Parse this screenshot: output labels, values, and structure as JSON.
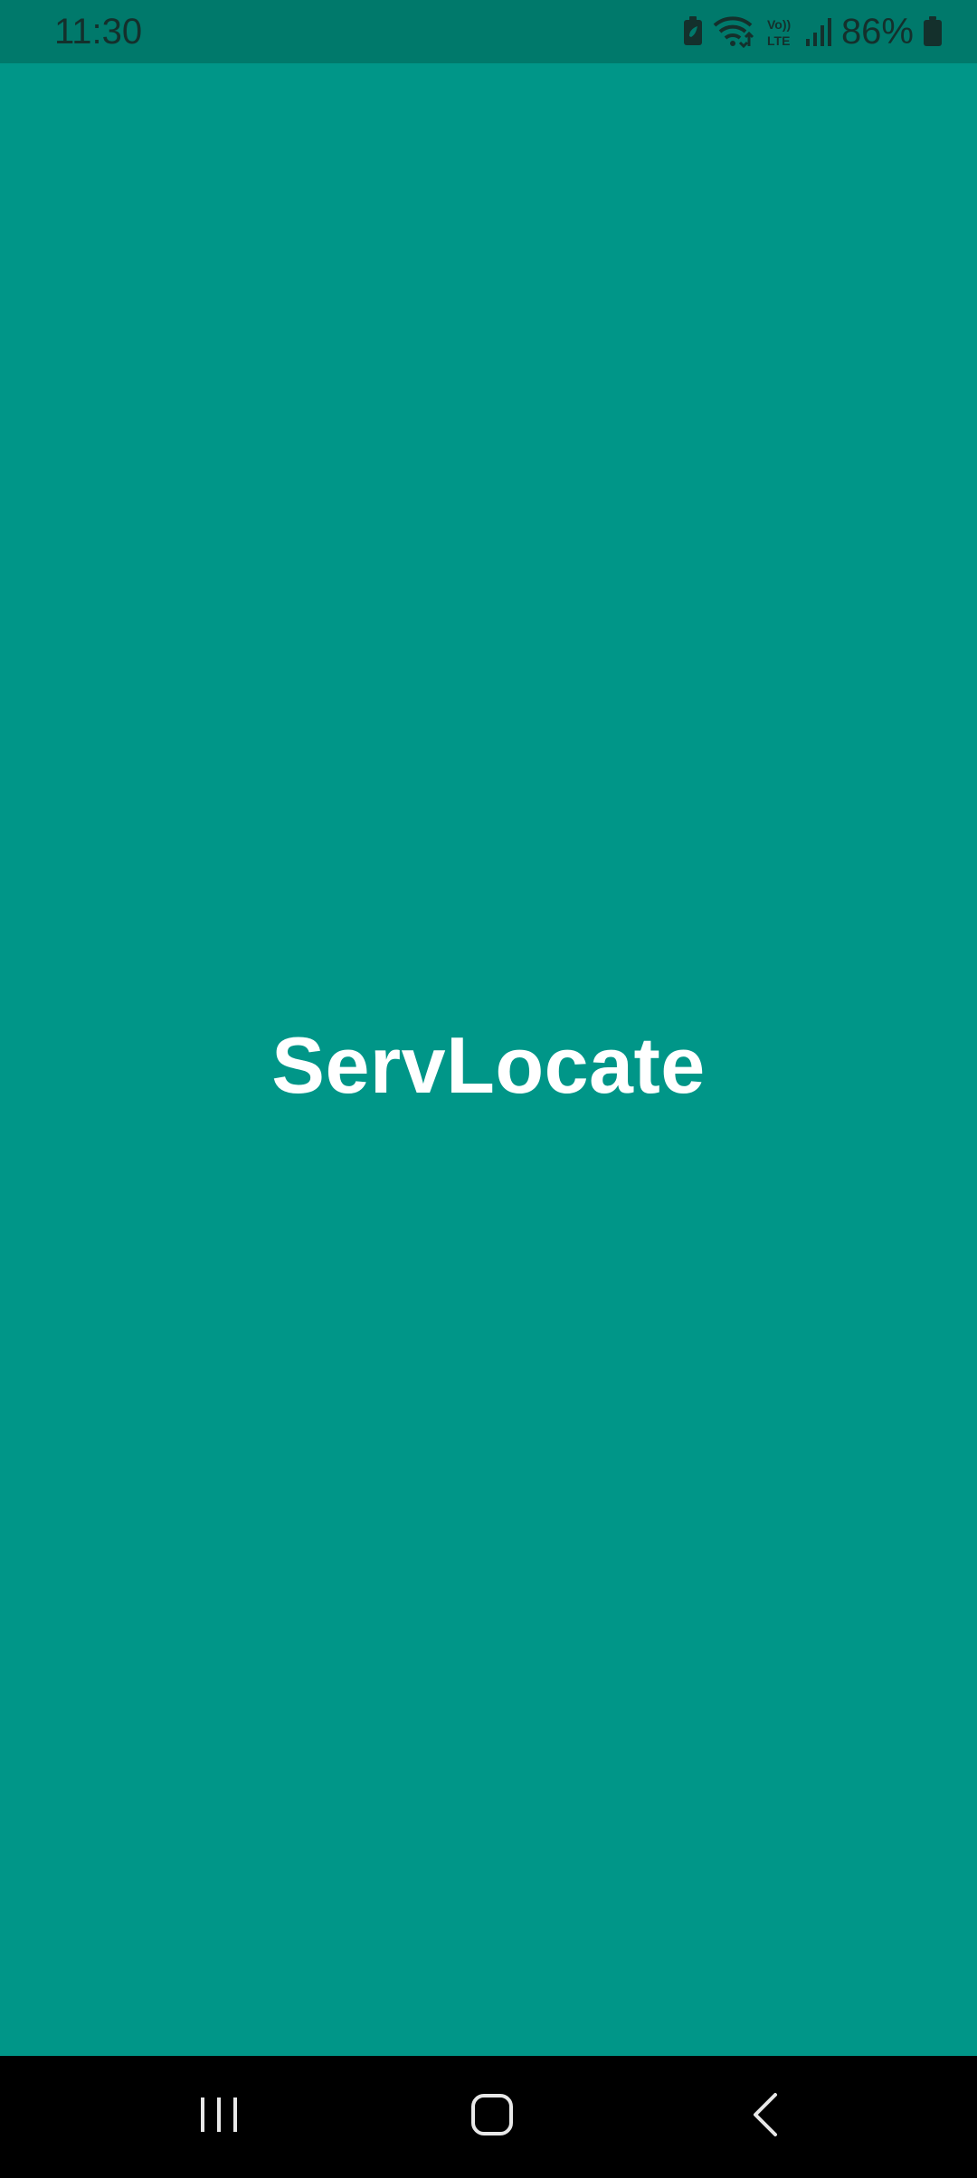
{
  "status_bar": {
    "time": "11:30",
    "battery_percent": "86%",
    "icons": [
      "battery-saver-icon",
      "wifi-icon",
      "volte-lte-icon",
      "signal-icon",
      "battery-icon"
    ],
    "background_color": "#00796B"
  },
  "main": {
    "app_title": "ServLocate",
    "background_color": "#009688",
    "title_color": "#FFFFFF"
  },
  "nav_bar": {
    "buttons": [
      "recents-icon",
      "home-icon",
      "back-icon"
    ],
    "background_color": "#000000"
  }
}
